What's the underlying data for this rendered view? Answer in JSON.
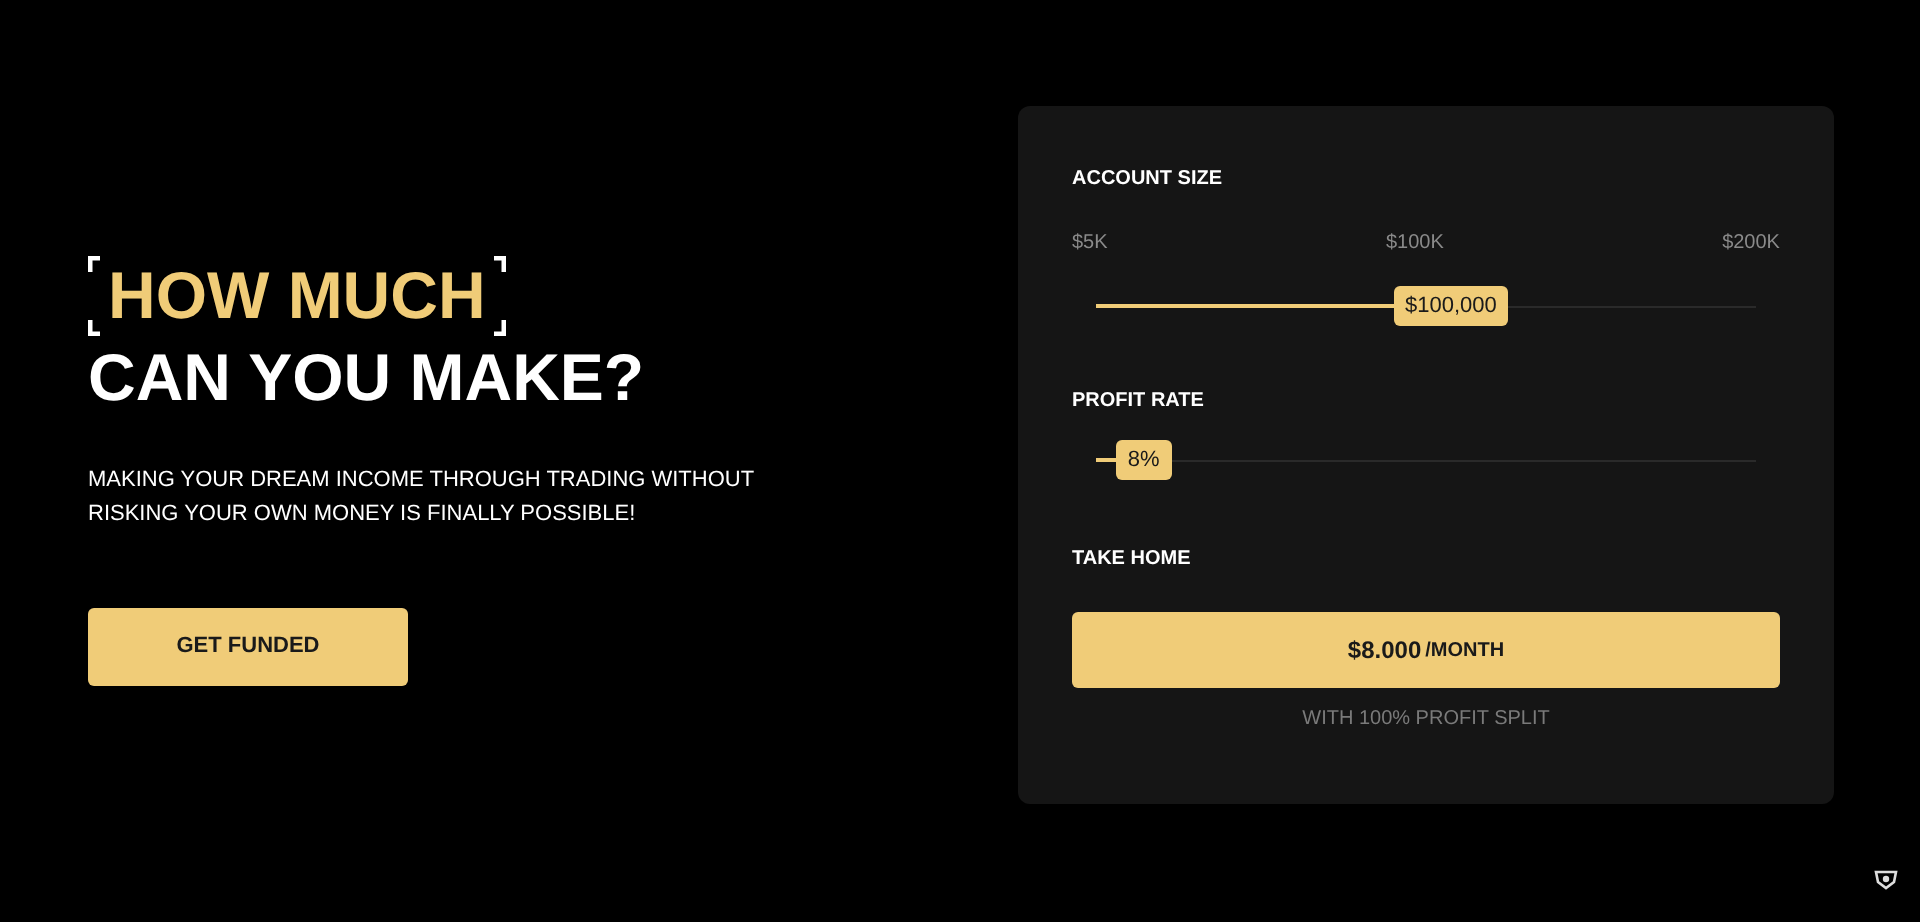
{
  "hero": {
    "title_highlight": "HOW MUCH",
    "title_rest": "CAN YOU MAKE?",
    "subtitle": "MAKING YOUR DREAM INCOME THROUGH TRADING WITHOUT RISKING YOUR OWN MONEY IS FINALLY POSSIBLE!",
    "button": "GET FUNDED"
  },
  "calculator": {
    "account_size": {
      "label": "ACCOUNT SIZE",
      "ticks": [
        "$5K",
        "$100K",
        "$200K"
      ],
      "value": "$100,000",
      "level": 0.45
    },
    "profit_rate": {
      "label": "PROFIT RATE",
      "value": "8%",
      "level": 0.03
    },
    "take_home": {
      "label": "TAKE HOME",
      "amount": "$8.000",
      "unit": "/MONTH",
      "note": "WITH 100% PROFIT SPLIT"
    }
  }
}
